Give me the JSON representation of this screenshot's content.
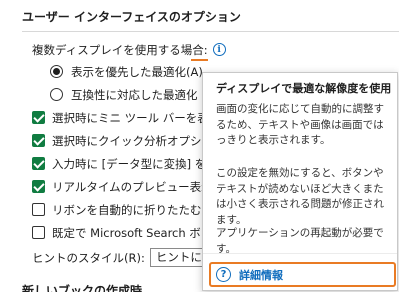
{
  "section": {
    "title": "ユーザー インターフェイスのオプション"
  },
  "multi_display": {
    "label": "複数ディスプレイを使用する場合:",
    "info_glyph": "i",
    "options": [
      {
        "label": "表示を優先した最適化(A)",
        "selected": true
      },
      {
        "label": "互換性に対応した最適化 (",
        "selected": false
      }
    ]
  },
  "checkboxes": [
    {
      "label": "選択時にミニ ツール バーを表示",
      "checked": true
    },
    {
      "label": "選択時にクイック分析オプションを",
      "checked": true
    },
    {
      "label": "入力時に [データ型に変換] を表",
      "checked": true
    },
    {
      "label": "リアルタイムのプレビュー表示機能",
      "checked": true
    },
    {
      "label": "リボンを自動的に折りたたむ(N)",
      "checked": false
    },
    {
      "label": "既定で Microsoft Search ボ",
      "checked": false
    }
  ],
  "hint_style": {
    "label": "ヒントのスタイル(R):",
    "value": "ヒントに機能"
  },
  "tooltip": {
    "title": "ディスプレイで最適な解像度を使用",
    "para1": "画面の変化に応じて自動的に調整するため、テキストや画像は画面ではっきりと表示されます。",
    "para2": "この設定を無効にすると、ボタンやテキストが読めないほど大きくまたは小さく表示される問題が修正されます。",
    "para3": "アプリケーションの再起動が必要です。",
    "help_glyph": "?",
    "link_label": "詳細情報"
  },
  "next_section": {
    "title": "新しいブックの作成時"
  },
  "icons": {
    "info": "info-icon",
    "help": "help-circle-icon"
  },
  "colors": {
    "accent": "#0f6cbd",
    "checkbox": "#107c41",
    "focus": "#e97b24"
  }
}
